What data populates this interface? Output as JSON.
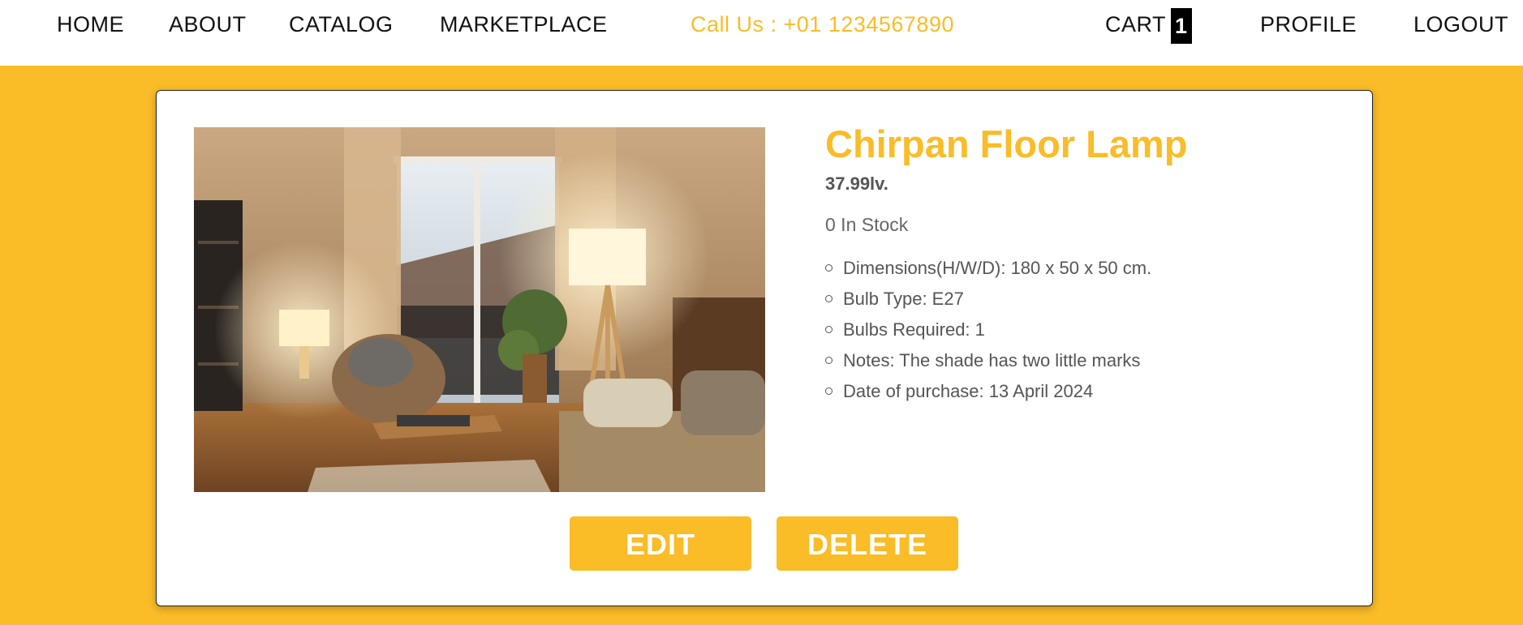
{
  "nav": {
    "home": "HOME",
    "about": "ABOUT",
    "catalog": "CATALOG",
    "marketplace": "MARKETPLACE",
    "phone": "Call Us : +01 1234567890",
    "cart": "CART",
    "cart_count": "1",
    "profile": "PROFILE",
    "logout": "LOGOUT"
  },
  "product": {
    "title": "Chirpan Floor Lamp",
    "price": "37.99lv.",
    "stock": "0 In Stock",
    "details": [
      "Dimensions(H/W/D): 180 x 50 x 50 cm.",
      "Bulb Type: E27",
      "Bulbs Required: 1",
      "Notes: The shade has two little marks",
      "Date of purchase: 13 April 2024"
    ]
  },
  "actions": {
    "edit": "EDIT",
    "delete": "DELETE"
  },
  "colors": {
    "accent": "#FABC27",
    "background": "#FABC27",
    "card": "#FFFFFF",
    "cart_badge": "#000000"
  }
}
